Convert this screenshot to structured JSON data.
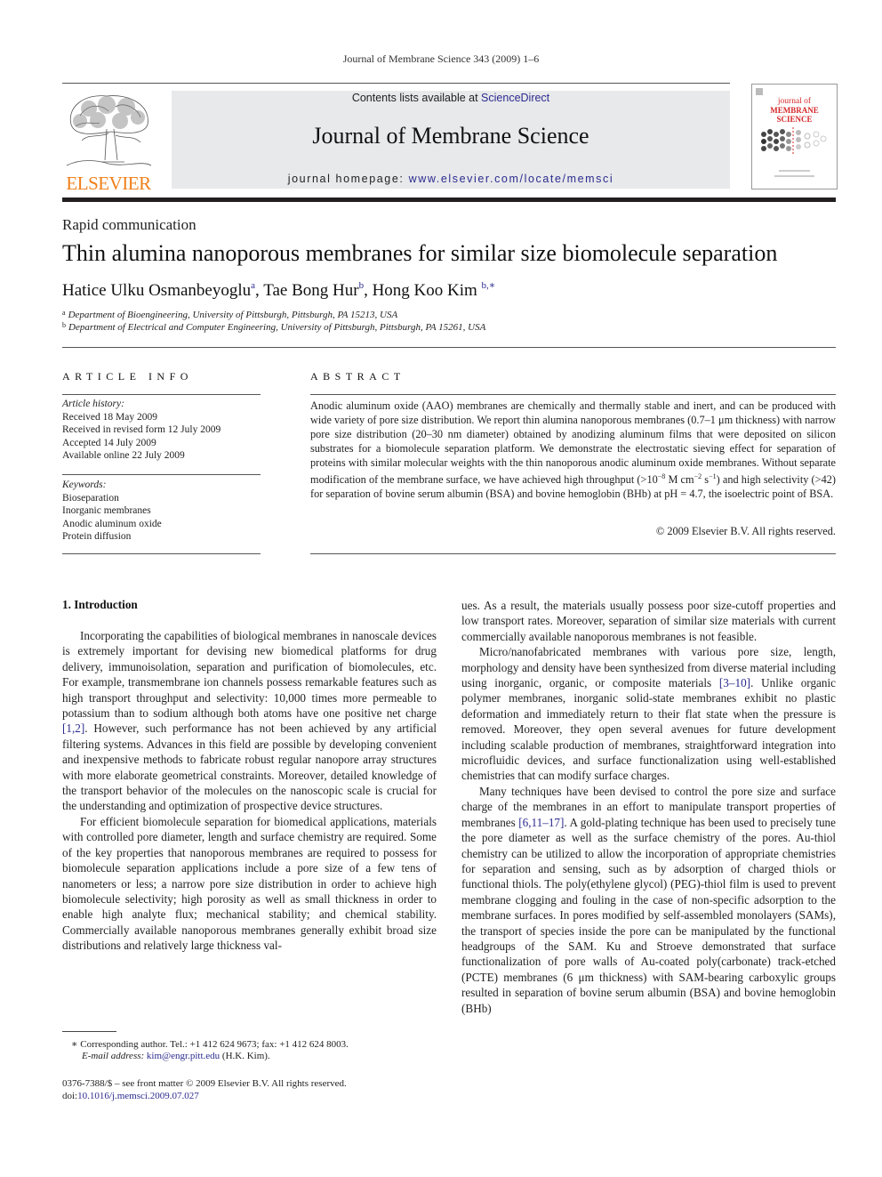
{
  "running_head": "Journal of Membrane Science 343 (2009) 1–6",
  "header": {
    "publisher_wordmark": "ELSEVIER",
    "contents_prefix": "Contents lists available at ",
    "contents_link": "ScienceDirect",
    "journal_name": "Journal of Membrane Science",
    "homepage_prefix": "journal homepage: ",
    "homepage_link": "www.elsevier.com/locate/memsci",
    "cover_title_line1": "journal of",
    "cover_title_line2": "MEMBRANE",
    "cover_title_line3": "SCIENCE",
    "colors": {
      "elsevier_orange": "#f07f1a",
      "cover_red": "#d4282a",
      "link_blue": "#2b2b8f",
      "banner_gray": "#e8e9eb"
    }
  },
  "article": {
    "type": "Rapid communication",
    "title": "Thin alumina nanoporous membranes for similar size biomolecule separation",
    "authors": [
      {
        "name": "Hatice Ulku Osmanbeyoglu",
        "sup": "a"
      },
      {
        "name": "Tae Bong Hur",
        "sup": "b"
      },
      {
        "name": "Hong Koo Kim",
        "sup": "b,∗"
      }
    ],
    "affiliations": [
      {
        "mark": "a",
        "text": "Department of Bioengineering, University of Pittsburgh, Pittsburgh, PA 15213, USA"
      },
      {
        "mark": "b",
        "text": "Department of Electrical and Computer Engineering, University of Pittsburgh, Pittsburgh, PA 15261, USA"
      }
    ]
  },
  "article_info": {
    "heading": "ARTICLE INFO",
    "history_label": "Article history:",
    "history": [
      "Received 18 May 2009",
      "Received in revised form 12 July 2009",
      "Accepted 14 July 2009",
      "Available online 22 July 2009"
    ],
    "keywords_label": "Keywords:",
    "keywords": [
      "Bioseparation",
      "Inorganic membranes",
      "Anodic aluminum oxide",
      "Protein diffusion"
    ]
  },
  "abstract": {
    "heading": "ABSTRACT",
    "text_1": "Anodic aluminum oxide (AAO) membranes are chemically and thermally stable and inert, and can be produced with wide variety of pore size distribution. We report thin alumina nanoporous membranes (0.7–1 μm thickness) with narrow pore size distribution (20–30 nm diameter) obtained by anodizing aluminum films that were deposited on silicon substrates for a biomolecule separation platform. We demonstrate the electrostatic sieving effect for separation of proteins with similar molecular weights with the thin nanoporous anodic aluminum oxide membranes. Without separate modification of the membrane surface, we have achieved high throughput (>10",
    "exp_1": "−8",
    "text_2": " M cm",
    "exp_2": "−2",
    "text_3": " s",
    "exp_3": "−1",
    "text_4": ") and high selectivity (>42) for separation of bovine serum albumin (BSA) and bovine hemoglobin (BHb) at pH = 4.7, the isoelectric point of BSA.",
    "copyright": "© 2009 Elsevier B.V. All rights reserved."
  },
  "body": {
    "section_heading": "1.  Introduction",
    "left": {
      "p1_a": "Incorporating the capabilities of biological membranes in nanoscale devices is extremely important for devising new biomedical platforms for drug delivery, immunoisolation, separation and purification of biomolecules, etc. For example, transmembrane ion channels possess remarkable features such as high transport throughput and selectivity: 10,000 times more permeable to potassium than to sodium although both atoms have one positive net charge ",
      "p1_ref": "[1,2]",
      "p1_b": ". However, such performance has not been achieved by any artificial filtering systems. Advances in this field are possible by developing convenient and inexpensive methods to fabricate robust regular nanopore array structures with more elaborate geometrical constraints. Moreover, detailed knowledge of the transport behavior of the molecules on the nanoscopic scale is crucial for the understanding and optimization of prospective device structures.",
      "p2": "For efficient biomolecule separation for biomedical applications, materials with controlled pore diameter, length and surface chemistry are required. Some of the key properties that nanoporous membranes are required to possess for biomolecule separation applications include a pore size of a few tens of nanometers or less; a narrow pore size distribution in order to achieve high biomolecule selectivity; high porosity as well as small thickness in order to enable high analyte flux; mechanical stability; and chemical stability. Commercially available nanoporous membranes generally exhibit broad size distributions and relatively large thickness val-"
    },
    "right": {
      "p0": "ues. As a result, the materials usually possess poor size-cutoff properties and low transport rates. Moreover, separation of similar size materials with current commercially available nanoporous membranes is not feasible.",
      "p1_a": "Micro/nanofabricated membranes with various pore size, length, morphology and density have been synthesized from diverse material including using inorganic, organic, or composite materials ",
      "p1_ref": "[3–10]",
      "p1_b": ". Unlike organic polymer membranes, inorganic solid-state membranes exhibit no plastic deformation and immediately return to their flat state when the pressure is removed. Moreover, they open several avenues for future development including scalable production of membranes, straightforward integration into microfluidic devices, and surface functionalization using well-established chemistries that can modify surface charges.",
      "p2_a": "Many techniques have been devised to control the pore size and surface charge of the membranes in an effort to manipulate transport properties of membranes ",
      "p2_ref": "[6,11–17]",
      "p2_b": ". A gold-plating technique has been used to precisely tune the pore diameter as well as the surface chemistry of the pores. Au-thiol chemistry can be utilized to allow the incorporation of appropriate chemistries for separation and sensing, such as by adsorption of charged thiols or functional thiols. The poly(ethylene glycol) (PEG)-thiol film is used to prevent membrane clogging and fouling in the case of non-specific adsorption to the membrane surfaces. In pores modified by self-assembled monolayers (SAMs), the transport of species inside the pore can be manipulated by the functional headgroups of the SAM. Ku and Stroeve demonstrated that surface functionalization of pore walls of Au-coated poly(carbonate) track-etched (PCTE) membranes (6 μm thickness) with SAM-bearing carboxylic groups resulted in separation of bovine serum albumin (BSA) and bovine hemoglobin (BHb)"
    }
  },
  "footnotes": {
    "corresponding": "∗   Corresponding author. Tel.: +1 412 624 9673; fax: +1 412 624 8003.",
    "email_label": "E-mail address: ",
    "email": "kim@engr.pitt.edu",
    "email_suffix": " (H.K. Kim).",
    "front_matter": "0376-7388/$ – see front matter © 2009 Elsevier B.V. All rights reserved.",
    "doi_prefix": "doi:",
    "doi": "10.1016/j.memsci.2009.07.027"
  }
}
